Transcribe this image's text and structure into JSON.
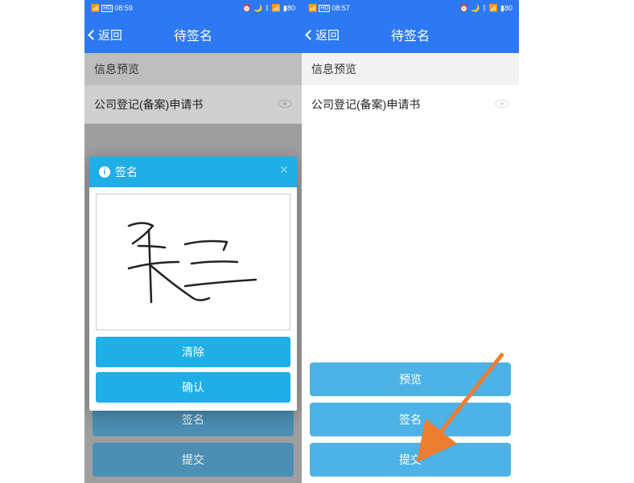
{
  "status_bar": {
    "time_left": "08:59",
    "time_right": "08:57",
    "signal": "📶",
    "battery": "80"
  },
  "nav": {
    "back": "返回",
    "title": "待签名"
  },
  "section": {
    "header": "信息预览",
    "item1": "公司登记(备案)申请书"
  },
  "buttons": {
    "preview": "预览",
    "sign": "签名",
    "submit": "提交"
  },
  "dialog": {
    "title": "签名",
    "clear": "清除",
    "confirm": "确认"
  }
}
